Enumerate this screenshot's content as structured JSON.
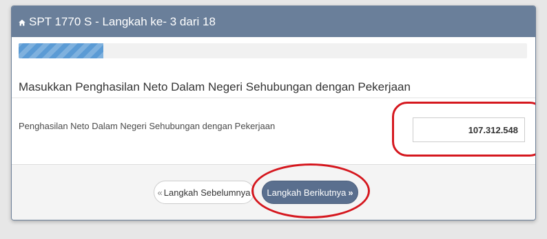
{
  "header": {
    "title": "SPT 1770 S - Langkah ke- 3 dari 18",
    "icon": "home-icon"
  },
  "progress": {
    "current_step": 3,
    "total_steps": 18,
    "fraction": 0.1667
  },
  "section": {
    "title": "Masukkan Penghasilan Neto Dalam Negeri Sehubungan dengan Pekerjaan"
  },
  "field": {
    "label": "Penghasilan Neto Dalam Negeri Sehubungan dengan Pekerjaan",
    "value": "107.312.548"
  },
  "buttons": {
    "prev_label": "Langkah Sebelumnya",
    "next_label": "Langkah Berikutnya",
    "prev_icon": "chevron-double-left-icon",
    "next_icon": "chevron-double-right-icon"
  },
  "colors": {
    "header_bg": "#6a7f9a",
    "progress_fill": "#5b9bd5",
    "next_button_bg": "#5a6f8e",
    "annotation": "#d5171e"
  }
}
